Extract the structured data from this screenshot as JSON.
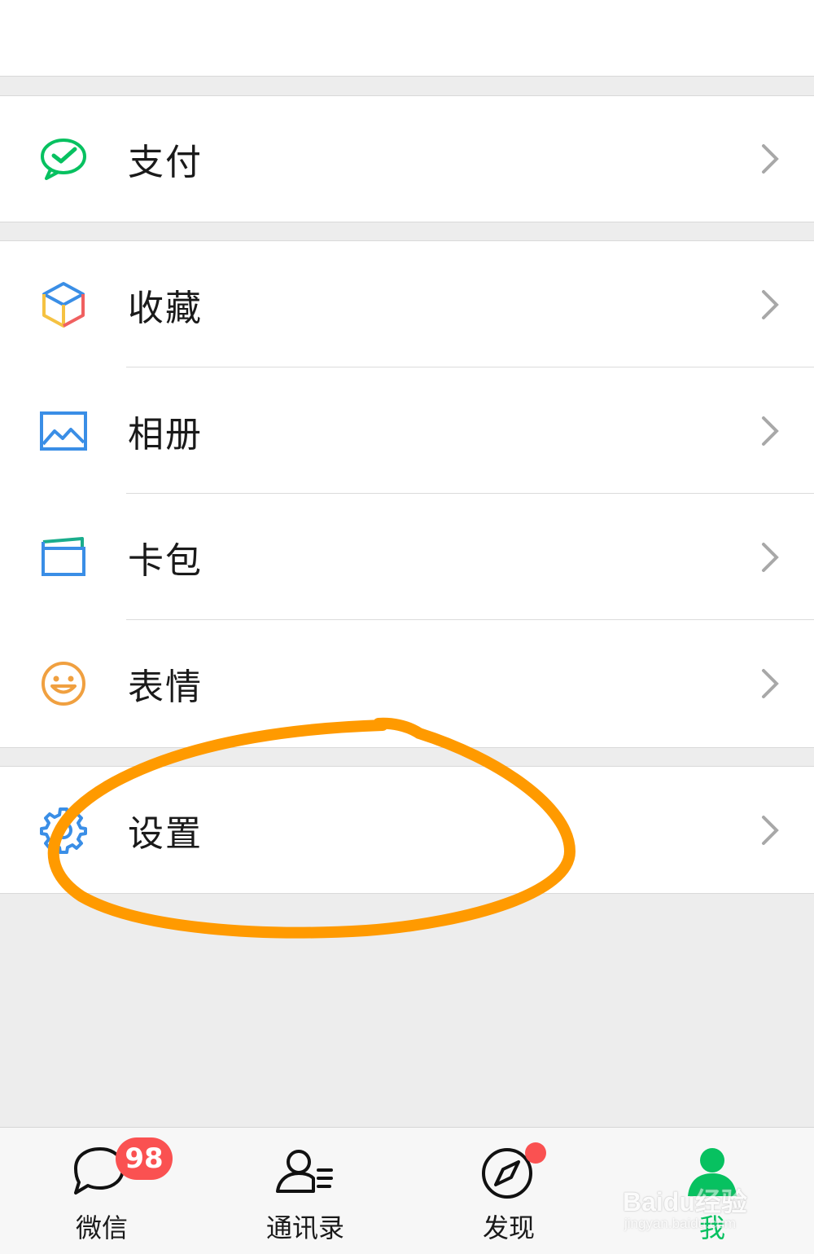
{
  "menu": {
    "pay": {
      "label": "支付",
      "icon": "wechat-pay-icon"
    },
    "favorites": {
      "label": "收藏",
      "icon": "cube-icon"
    },
    "album": {
      "label": "相册",
      "icon": "image-icon"
    },
    "cards": {
      "label": "卡包",
      "icon": "card-wallet-icon"
    },
    "stickers": {
      "label": "表情",
      "icon": "smiley-icon"
    },
    "settings": {
      "label": "设置",
      "icon": "gear-icon"
    }
  },
  "tabbar": {
    "tabs": [
      {
        "label": "微信",
        "icon": "chat-bubble-icon",
        "badge": "98"
      },
      {
        "label": "通讯录",
        "icon": "contacts-icon"
      },
      {
        "label": "发现",
        "icon": "compass-icon",
        "dot": true
      },
      {
        "label": "我",
        "icon": "person-icon",
        "active": true
      }
    ]
  },
  "watermark": {
    "main": "Baidu经验",
    "sub": "jingyan.baidu.com"
  },
  "colors": {
    "accent": "#07c160",
    "badge": "#fa5151",
    "annotation": "#ff9a00",
    "background": "#ededed",
    "settings_icon": "#3a8ee6"
  }
}
